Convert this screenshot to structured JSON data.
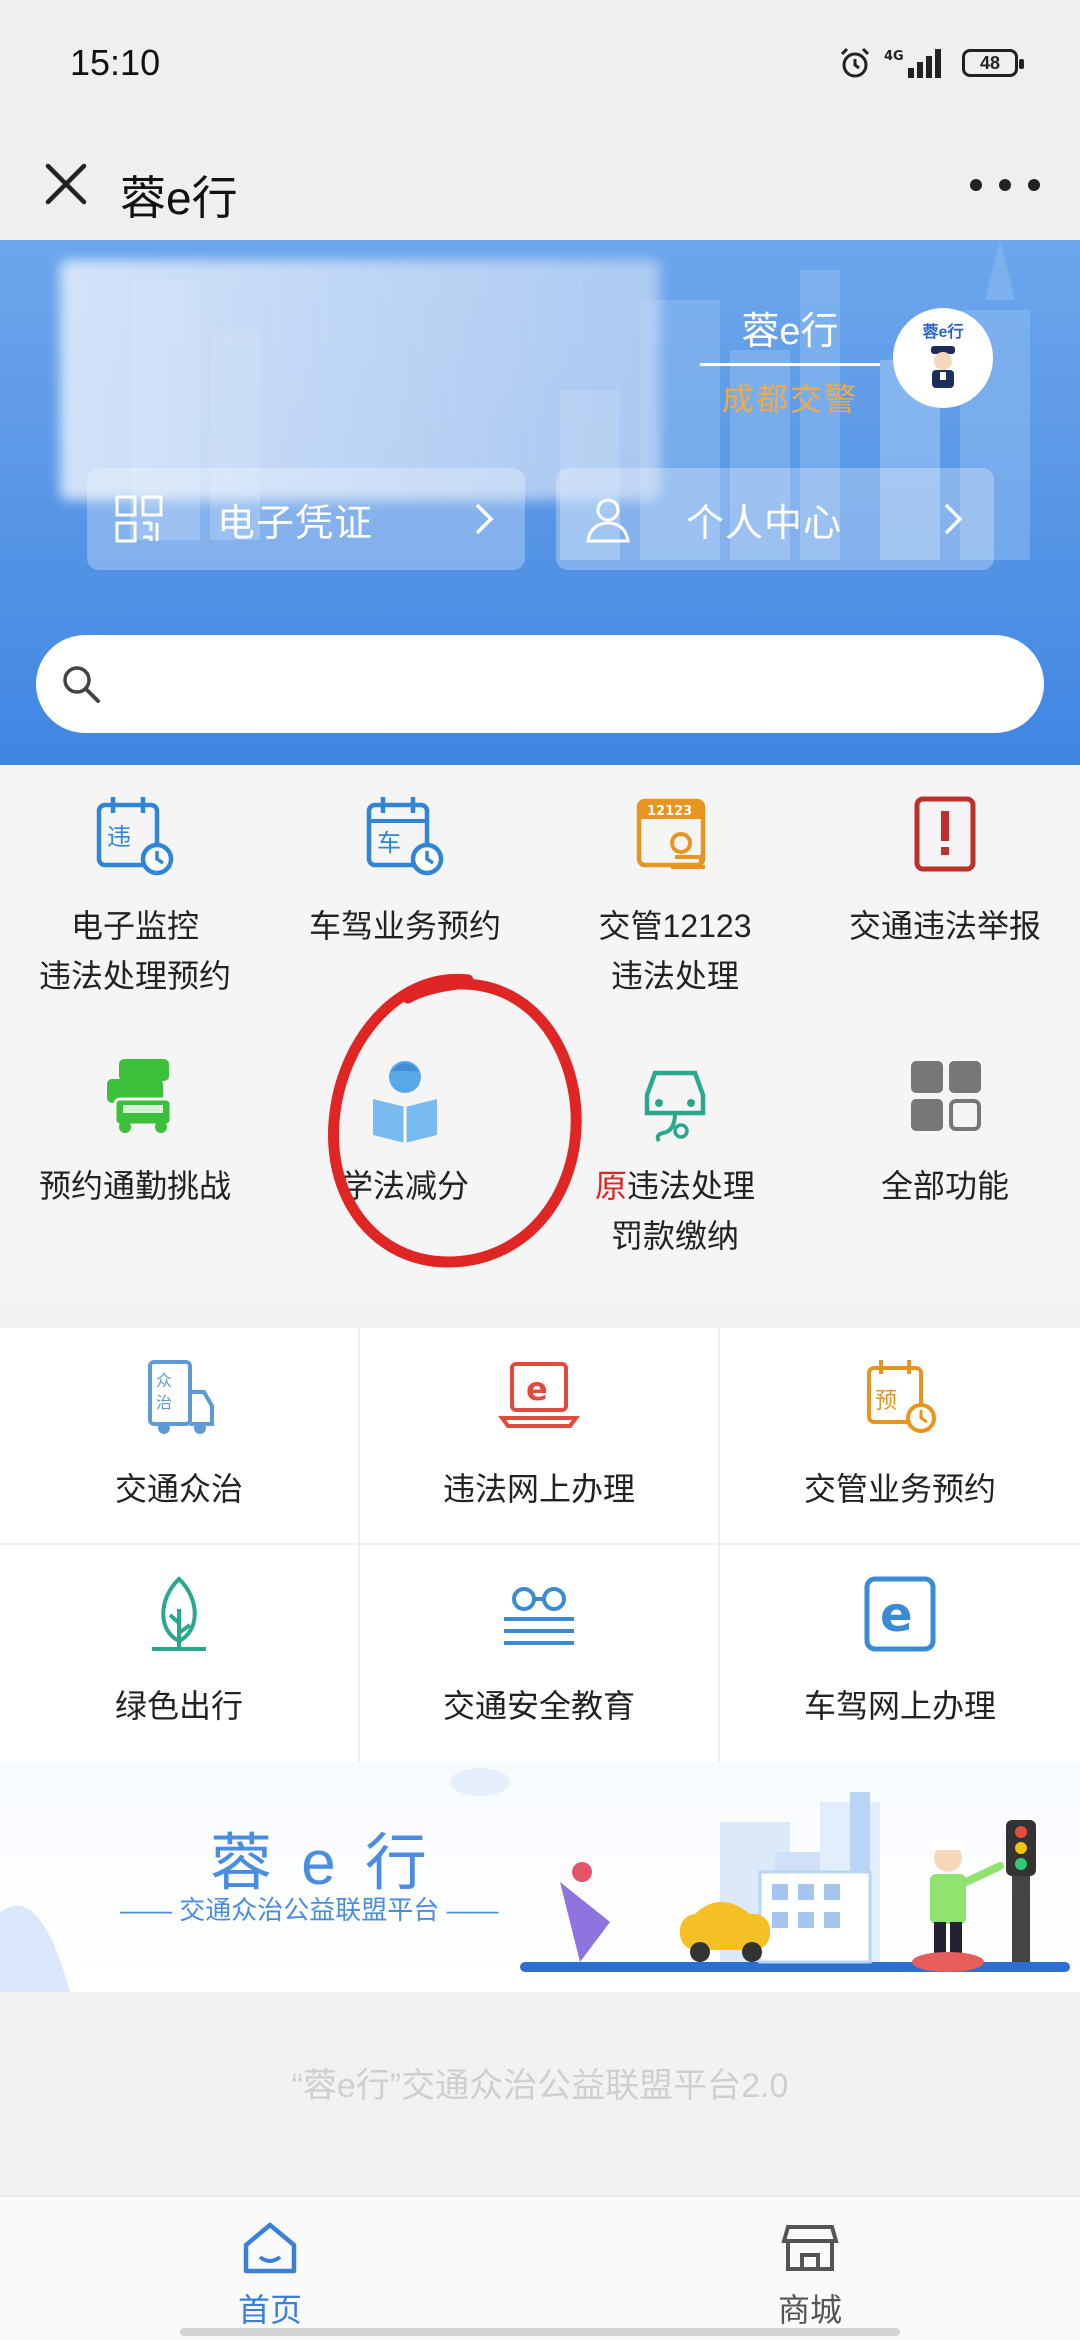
{
  "status_bar": {
    "time": "15:10",
    "network": "4G",
    "battery": "48"
  },
  "title_bar": {
    "title": "蓉e行",
    "close_icon": "close-icon",
    "more_icon": "more-dots-icon"
  },
  "hero": {
    "brand_title": "蓉e行",
    "brand_sub": "成都交警",
    "buttons": [
      {
        "label": "电子凭证",
        "icon": "qrcode-icon"
      },
      {
        "label": "个人中心",
        "icon": "user-icon"
      }
    ],
    "search_placeholder": ""
  },
  "features": [
    {
      "line1": "电子监控",
      "line2": "违法处理预约",
      "icon": "violation-calendar-icon",
      "color": "#2f86d6"
    },
    {
      "line1": "车驾业务预约",
      "line2": "",
      "icon": "vehicle-calendar-icon",
      "color": "#2f86d6"
    },
    {
      "line1": "交管12123",
      "line2": "违法处理",
      "icon": "app-12123-icon",
      "color": "#e8951f"
    },
    {
      "line1": "交通违法举报",
      "line2": "",
      "icon": "report-icon",
      "color": "#c0302a"
    },
    {
      "line1": "预约通勤挑战",
      "line2": "",
      "icon": "cars-icon",
      "color": "#3cbf3a"
    },
    {
      "line1": "学法减分",
      "line2": "",
      "icon": "study-reader-icon",
      "color": "#5aa8e8"
    },
    {
      "line1_prefix": "原",
      "line1": "违法处理",
      "line2": "罚款缴纳",
      "icon": "car-pay-icon",
      "color": "#2aa88e"
    },
    {
      "line1": "全部功能",
      "line2": "",
      "icon": "all-grid-icon",
      "color": "#777777"
    }
  ],
  "services": [
    {
      "label": "交通众治",
      "icon": "co-governance-icon"
    },
    {
      "label": "违法网上办理",
      "icon": "laptop-e-icon"
    },
    {
      "label": "交管业务预约",
      "icon": "appointment-calendar-icon"
    },
    {
      "label": "绿色出行",
      "icon": "green-leaf-icon"
    },
    {
      "label": "交通安全教育",
      "icon": "glasses-book-icon"
    },
    {
      "label": "车驾网上办理",
      "icon": "e-box-icon"
    }
  ],
  "banner": {
    "title": "蓉 e 行",
    "subtitle": "—— 交通众治公益联盟平台 ——"
  },
  "footer_note": "“蓉e行”交通众治公益联盟平台2.0",
  "tabs": [
    {
      "label": "首页",
      "icon": "home-icon",
      "active": true
    },
    {
      "label": "商城",
      "icon": "store-icon",
      "active": false
    }
  ],
  "colors": {
    "accent": "#3a7fd8",
    "hero_blue": "#4a8de5",
    "annotation_red": "#e02525"
  }
}
